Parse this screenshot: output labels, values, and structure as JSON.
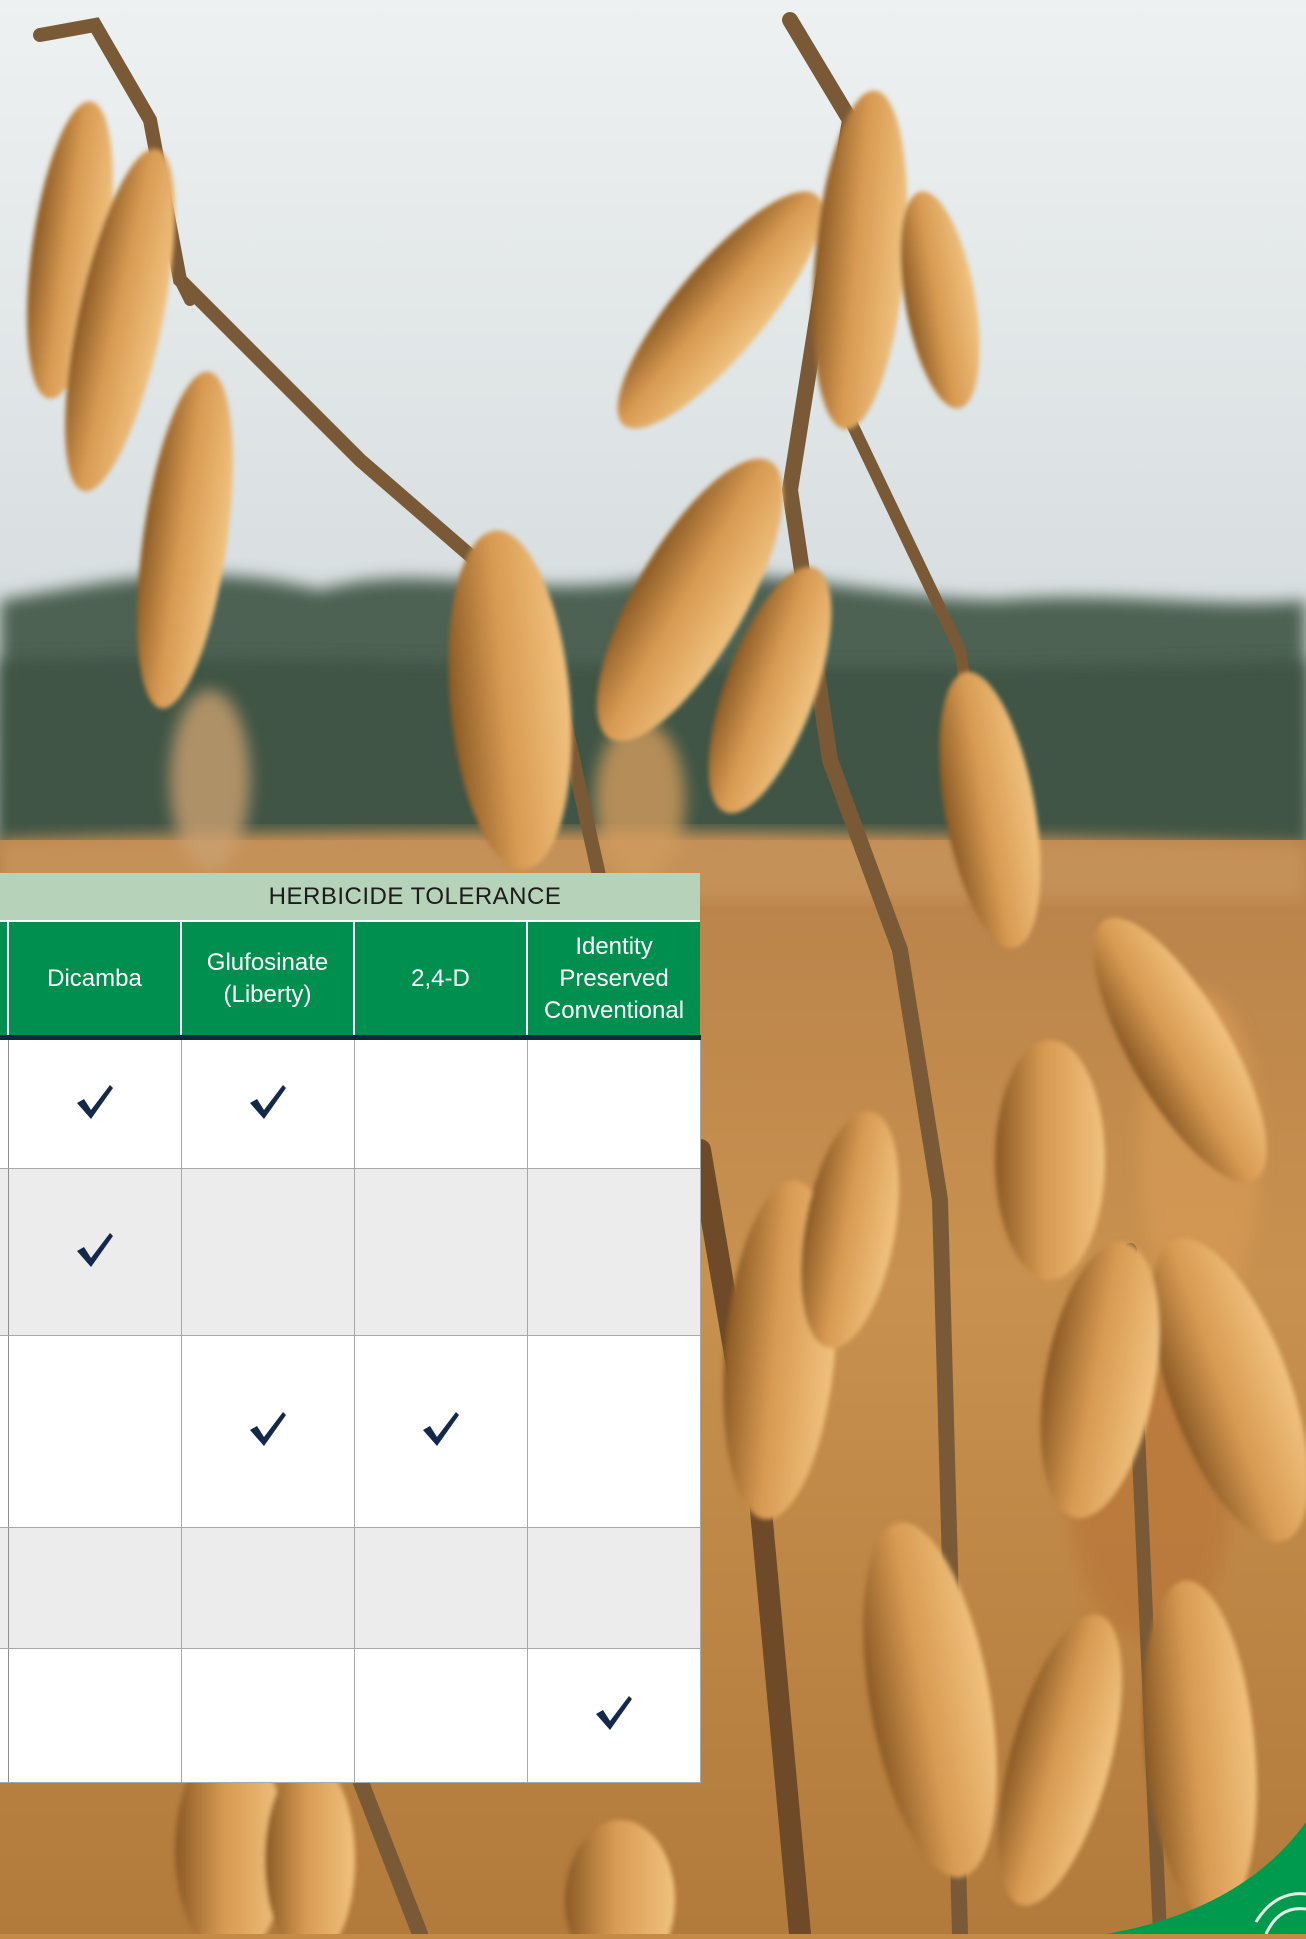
{
  "colors": {
    "band": "#b6d2b9",
    "header": "#008f4f",
    "header_rule": "#0e2a3a",
    "check": "#13284a",
    "row_alt": "#ececec",
    "corner": "#009a4e"
  },
  "icons": {
    "check": "check-icon",
    "photo": "soybean-pods-photo",
    "corner": "brand-corner-swoosh"
  },
  "table": {
    "band_title": "HERBICIDE TOLERANCE",
    "columns": [
      {
        "label": ""
      },
      {
        "label": "Dicamba"
      },
      {
        "label": "Glufosinate\n(Liberty)"
      },
      {
        "label": "2,4-D"
      },
      {
        "label": "Identity\nPreserved\nConventional"
      }
    ],
    "rows": [
      {
        "checks": [
          true,
          true,
          false,
          false
        ]
      },
      {
        "checks": [
          true,
          false,
          false,
          false
        ]
      },
      {
        "checks": [
          false,
          true,
          true,
          false
        ]
      },
      {
        "checks": [
          false,
          false,
          false,
          false
        ]
      },
      {
        "checks": [
          false,
          false,
          false,
          true
        ]
      }
    ]
  }
}
